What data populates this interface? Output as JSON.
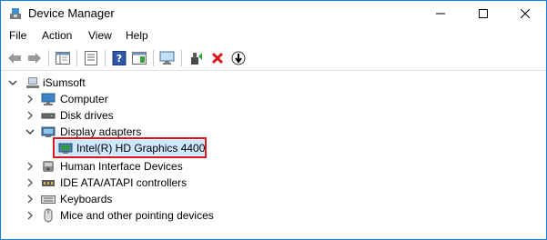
{
  "window": {
    "title": "Device Manager"
  },
  "menu": {
    "items": [
      "File",
      "Action",
      "View",
      "Help"
    ]
  },
  "tree": {
    "root": "iSumsoft",
    "nodes": [
      {
        "label": "Computer",
        "expanded": false
      },
      {
        "label": "Disk drives",
        "expanded": false
      },
      {
        "label": "Display adapters",
        "expanded": true
      },
      {
        "label": "Intel(R) HD Graphics 4400",
        "child": true,
        "selected": true
      },
      {
        "label": "Human Interface Devices",
        "expanded": false
      },
      {
        "label": "IDE ATA/ATAPI controllers",
        "expanded": false
      },
      {
        "label": "Keyboards",
        "expanded": false
      },
      {
        "label": "Mice and other pointing devices",
        "expanded": false
      }
    ]
  },
  "colors": {
    "accent_border": "#1a7fd8",
    "highlight_box": "#d6171e",
    "selection_bg": "#cde8ff"
  }
}
